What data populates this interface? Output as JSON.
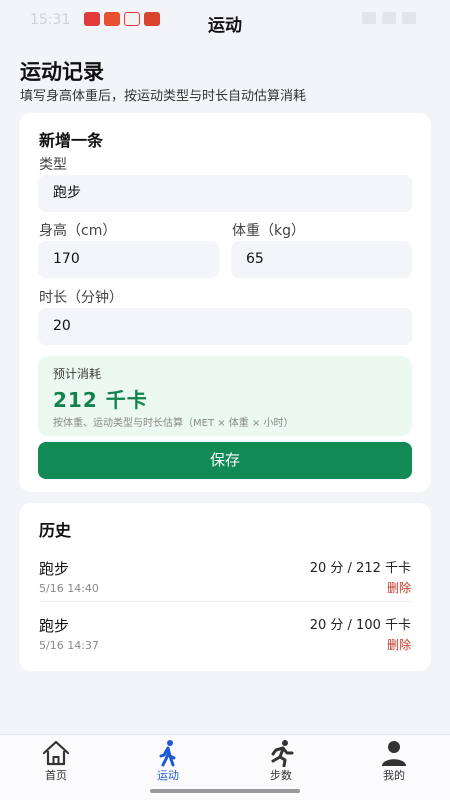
{
  "status_bar": {
    "time": "15:31",
    "title": "运动"
  },
  "header": {
    "title": "运动记录",
    "subtitle": "填写身高体重后，按运动类型与时长自动估算消耗"
  },
  "form": {
    "title": "新增一条",
    "type_label": "类型",
    "type_value": "跑步",
    "height_label": "身高（cm）",
    "height_value": "170",
    "weight_label": "体重（kg）",
    "weight_value": "65",
    "duration_label": "时长（分钟）",
    "duration_value": "20",
    "estimate": {
      "label": "预计消耗",
      "value": "212 千卡",
      "note": "按体重、运动类型与时长估算（MET × 体重 × 小时）"
    },
    "save_label": "保存"
  },
  "history": {
    "title": "历史",
    "items": [
      {
        "type": "跑步",
        "time": "5/16 14:40",
        "summary": "20 分 / 212 千卡",
        "delete_label": "删除"
      },
      {
        "type": "跑步",
        "time": "5/16 14:37",
        "summary": "20 分 / 100 千卡",
        "delete_label": "删除"
      }
    ]
  },
  "nav": {
    "items": [
      {
        "label": "首页",
        "icon": "home-icon"
      },
      {
        "label": "运动",
        "icon": "walking-person-icon",
        "active": true
      },
      {
        "label": "步数",
        "icon": "running-person-icon"
      },
      {
        "label": "我的",
        "icon": "user-icon"
      }
    ]
  },
  "colors": {
    "accent_green": "#128a55",
    "estimate_bg": "#ecf9f1",
    "delete_red": "#c0392b",
    "nav_active": "#1f5ad6"
  }
}
